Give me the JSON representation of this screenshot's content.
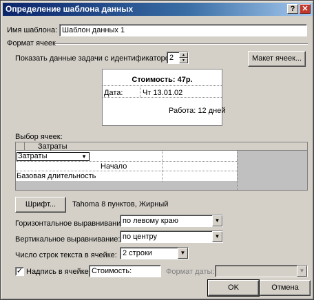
{
  "window": {
    "title": "Определение шаблона данных",
    "help_icon": "?",
    "close_icon": "✕"
  },
  "template_name": {
    "label": "Имя шаблона:",
    "value": "Шаблон данных 1"
  },
  "cell_format": {
    "group_label": "Формат ячеек",
    "show_task_label": "Показать данные задачи с идентификатором:",
    "task_id": "2",
    "layout_button": "Макет ячеек..."
  },
  "preview": {
    "cost": "Стоимость: 47р.",
    "date_label": "Дата:",
    "date_value": "Чт 13.01.02",
    "work": "Работа: 12 дней"
  },
  "cell_choice": {
    "label": "Выбор ячеек:",
    "rows": [
      "Затраты",
      "Затраты",
      "Начало",
      "Базовая длительность"
    ]
  },
  "font": {
    "button": "Шрифт...",
    "description": "Tahoma 8 пунктов, Жирный"
  },
  "h_align": {
    "label": "Горизонтальное выравнивание:",
    "value": "по левому краю"
  },
  "v_align": {
    "label": "Вертикальное выравнивание:",
    "value": "по центру"
  },
  "lines": {
    "label": "Число строк текста в ячейке:",
    "value": "2 строки"
  },
  "cell_caption": {
    "label": "Надпись в ячейке:",
    "value": "Стоимость:",
    "checked": true
  },
  "date_format": {
    "label": "Формат даты:",
    "value": ""
  },
  "buttons": {
    "ok": "OK",
    "cancel": "Отмена"
  },
  "colors": {
    "title_start": "#0a246a",
    "title_end": "#a6caf0",
    "dialog_face": "#d4d0c8"
  }
}
